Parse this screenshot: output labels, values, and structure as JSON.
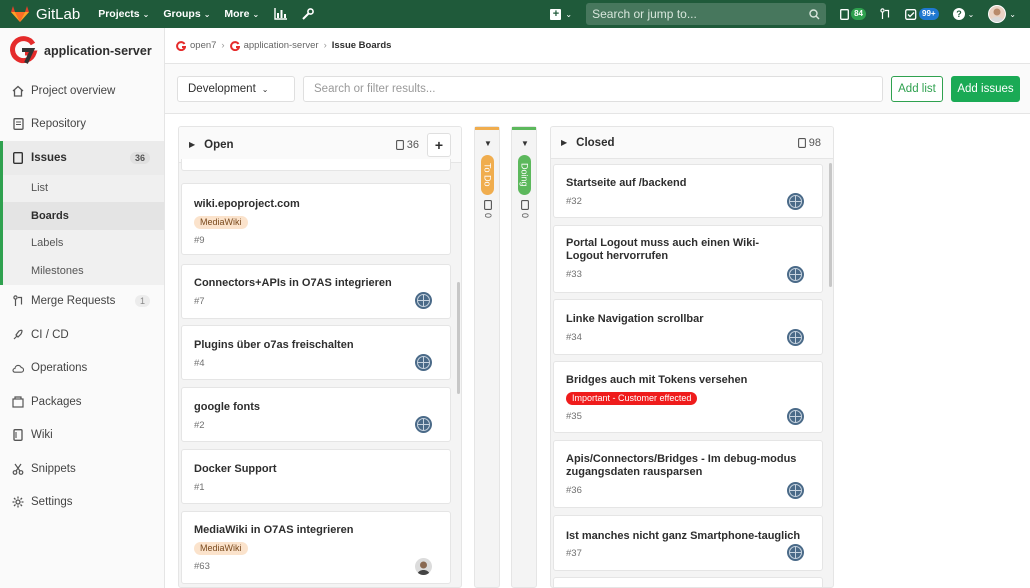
{
  "topnav": {
    "brand": "GitLab",
    "menu": [
      {
        "label": "Projects"
      },
      {
        "label": "Groups"
      },
      {
        "label": "More"
      }
    ],
    "search_placeholder": "Search or jump to...",
    "issues_count": "84",
    "todos_count": "99+"
  },
  "sidebar": {
    "project_name": "application-server",
    "items": [
      {
        "label": "Project overview"
      },
      {
        "label": "Repository"
      },
      {
        "label": "Issues",
        "count": "36"
      },
      {
        "label": "Merge Requests",
        "count": "1"
      },
      {
        "label": "CI / CD"
      },
      {
        "label": "Operations"
      },
      {
        "label": "Packages"
      },
      {
        "label": "Wiki"
      },
      {
        "label": "Snippets"
      },
      {
        "label": "Settings"
      }
    ],
    "issues_sub": [
      {
        "label": "List"
      },
      {
        "label": "Boards"
      },
      {
        "label": "Labels"
      },
      {
        "label": "Milestones"
      }
    ]
  },
  "breadcrumb": {
    "group": "open7",
    "project": "application-server",
    "current": "Issue Boards"
  },
  "filterbar": {
    "board": "Development",
    "filter_placeholder": "Search or filter results...",
    "add_list": "Add list",
    "add_issues": "Add issues"
  },
  "board": {
    "open": {
      "title": "Open",
      "count": "36",
      "cards": [
        {
          "title": "wiki.epoproject.com",
          "label": "MediaWiki",
          "ref": "#9"
        },
        {
          "title": "Connectors+APIs in O7AS integrieren",
          "ref": "#7"
        },
        {
          "title": "Plugins über o7as freischalten",
          "ref": "#4"
        },
        {
          "title": "google fonts",
          "ref": "#2"
        },
        {
          "title": "Docker Support",
          "ref": "#1"
        },
        {
          "title": "MediaWiki in O7AS integrieren",
          "label": "MediaWiki",
          "ref": "#63"
        }
      ]
    },
    "todo": {
      "title": "To Do",
      "count": "0",
      "color": "#f0ad4e"
    },
    "doing": {
      "title": "Doing",
      "count": "0",
      "color": "#5cb85c"
    },
    "closed": {
      "title": "Closed",
      "count": "98",
      "cards": [
        {
          "title": "Startseite auf /backend",
          "ref": "#32"
        },
        {
          "title": "Portal Logout muss auch einen Wiki-Logout hervorrufen",
          "ref": "#33"
        },
        {
          "title": "Linke Navigation scrollbar",
          "ref": "#34"
        },
        {
          "title": "Bridges auch mit Tokens versehen",
          "label": "Important - Customer effected",
          "ref": "#35"
        },
        {
          "title": "Apis/Connectors/Bridges - Im debug-modus zugangsdaten rausparsen",
          "ref": "#36"
        },
        {
          "title": "Ist manches nicht ganz Smartphone-tauglich",
          "ref": "#37"
        }
      ]
    }
  }
}
